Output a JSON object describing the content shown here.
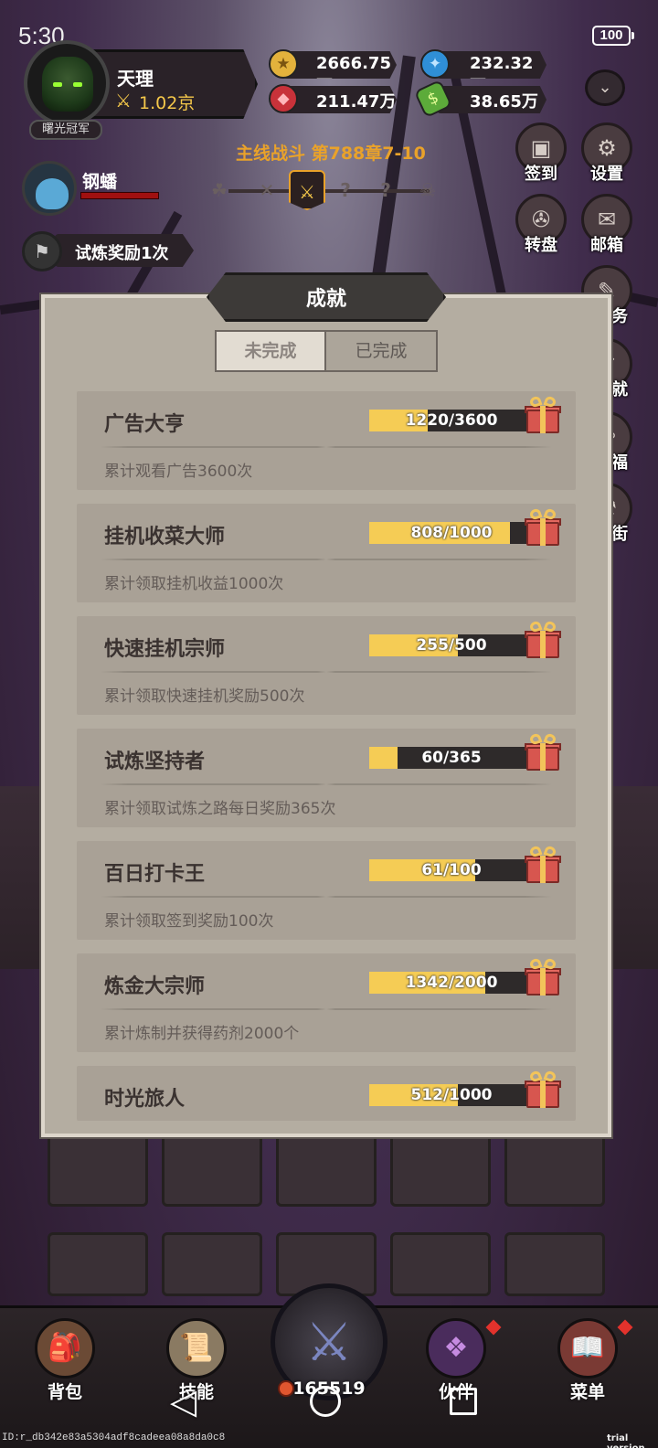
{
  "status_bar": {
    "time": "5:30",
    "battery": "100"
  },
  "player": {
    "name": "天理",
    "power": "1.02京",
    "title_badge": "曙光冠军"
  },
  "currencies": [
    {
      "name": "gold",
      "icon": "gold-coin-icon",
      "value": "2666.75万",
      "color": "#e3b23c"
    },
    {
      "name": "gem-blue",
      "icon": "blue-gem-icon",
      "value": "232.32万",
      "color": "#2f8fd6"
    },
    {
      "name": "gem-red",
      "icon": "red-gem-icon",
      "value": "211.47万",
      "color": "#c8323a"
    },
    {
      "name": "cash",
      "icon": "green-cash-icon",
      "value": "38.65万",
      "color": "#5cab3a"
    }
  ],
  "stage": {
    "title": "主线战斗 第788章7-10",
    "nodes": [
      "☘",
      "✕",
      "⚔",
      "?",
      "?",
      "☠"
    ]
  },
  "pet": {
    "name": "钢蟠"
  },
  "trial": {
    "label": "试炼奖励1次"
  },
  "side_menu": [
    {
      "label": "签到",
      "icon": "calendar-icon"
    },
    {
      "label": "设置",
      "icon": "gear-icon"
    },
    {
      "label": "转盘",
      "icon": "wheel-icon"
    },
    {
      "label": "邮箱",
      "icon": "mail-icon"
    },
    {
      "label": "务",
      "icon": "quest-icon"
    },
    {
      "label": "就",
      "icon": "trophy-icon"
    },
    {
      "label": "福",
      "icon": "welfare-icon"
    },
    {
      "label": "街",
      "icon": "shop-icon"
    }
  ],
  "panel": {
    "title": "成就",
    "tabs": {
      "active": "未完成",
      "inactive": "已完成"
    },
    "achievements": [
      {
        "title": "广告大亨",
        "description": "累计观看广告3600次",
        "progress_text": "1220/3600",
        "progress": 0.339
      },
      {
        "title": "挂机收菜大师",
        "description": "累计领取挂机收益1000次",
        "progress_text": "808/1000",
        "progress": 0.808
      },
      {
        "title": "快速挂机宗师",
        "description": "累计领取快速挂机奖励500次",
        "progress_text": "255/500",
        "progress": 0.51
      },
      {
        "title": "试炼坚持者",
        "description": "累计领取试炼之路每日奖励365次",
        "progress_text": "60/365",
        "progress": 0.164
      },
      {
        "title": "百日打卡王",
        "description": "累计领取签到奖励100次",
        "progress_text": "61/100",
        "progress": 0.61
      },
      {
        "title": "炼金大宗师",
        "description": "累计炼制并获得药剂2000个",
        "progress_text": "1342/2000",
        "progress": 0.671
      },
      {
        "title": "时光旅人",
        "description": "",
        "progress_text": "512/1000",
        "progress": 0.512
      }
    ]
  },
  "bottom_nav": {
    "items": [
      {
        "label": "背包",
        "icon": "backpack-icon"
      },
      {
        "label": "技能",
        "icon": "skill-scroll-icon"
      },
      {
        "label": "伙伴",
        "icon": "partner-wings-icon"
      },
      {
        "label": "菜单",
        "icon": "menu-book-icon"
      }
    ],
    "battle_count": "165519"
  },
  "footer": {
    "debug_id": "ID:r_db342e83a5304adf8cadeea08a8da0c8",
    "watermark": "trial version"
  }
}
